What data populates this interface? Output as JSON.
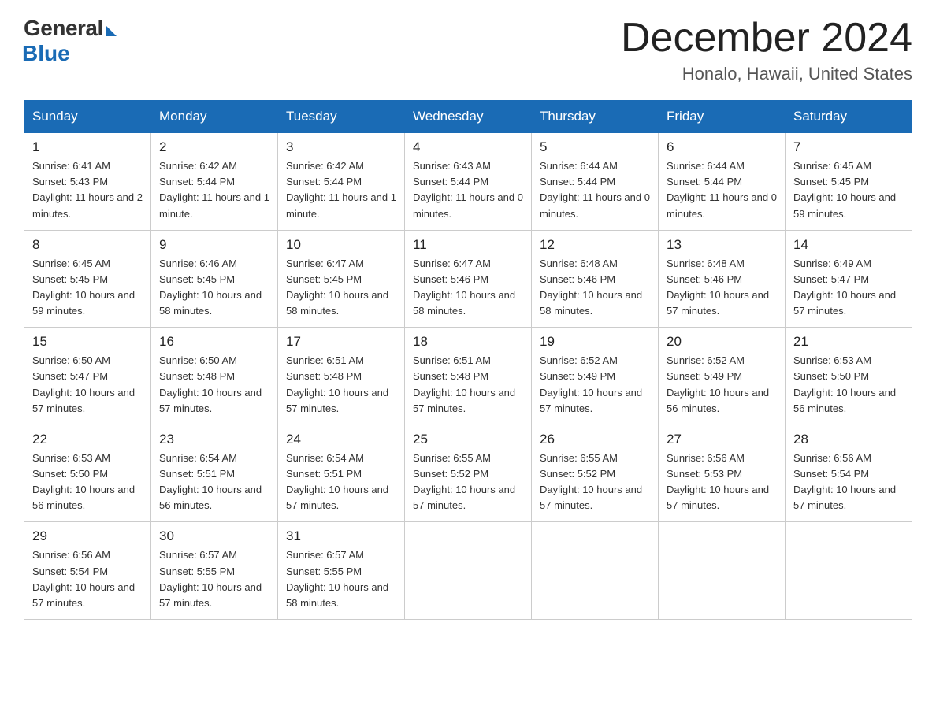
{
  "logo": {
    "general": "General",
    "blue": "Blue"
  },
  "title": "December 2024",
  "location": "Honalo, Hawaii, United States",
  "weekdays": [
    "Sunday",
    "Monday",
    "Tuesday",
    "Wednesday",
    "Thursday",
    "Friday",
    "Saturday"
  ],
  "weeks": [
    [
      {
        "day": "1",
        "sunrise": "6:41 AM",
        "sunset": "5:43 PM",
        "daylight": "11 hours and 2 minutes."
      },
      {
        "day": "2",
        "sunrise": "6:42 AM",
        "sunset": "5:44 PM",
        "daylight": "11 hours and 1 minute."
      },
      {
        "day": "3",
        "sunrise": "6:42 AM",
        "sunset": "5:44 PM",
        "daylight": "11 hours and 1 minute."
      },
      {
        "day": "4",
        "sunrise": "6:43 AM",
        "sunset": "5:44 PM",
        "daylight": "11 hours and 0 minutes."
      },
      {
        "day": "5",
        "sunrise": "6:44 AM",
        "sunset": "5:44 PM",
        "daylight": "11 hours and 0 minutes."
      },
      {
        "day": "6",
        "sunrise": "6:44 AM",
        "sunset": "5:44 PM",
        "daylight": "11 hours and 0 minutes."
      },
      {
        "day": "7",
        "sunrise": "6:45 AM",
        "sunset": "5:45 PM",
        "daylight": "10 hours and 59 minutes."
      }
    ],
    [
      {
        "day": "8",
        "sunrise": "6:45 AM",
        "sunset": "5:45 PM",
        "daylight": "10 hours and 59 minutes."
      },
      {
        "day": "9",
        "sunrise": "6:46 AM",
        "sunset": "5:45 PM",
        "daylight": "10 hours and 58 minutes."
      },
      {
        "day": "10",
        "sunrise": "6:47 AM",
        "sunset": "5:45 PM",
        "daylight": "10 hours and 58 minutes."
      },
      {
        "day": "11",
        "sunrise": "6:47 AM",
        "sunset": "5:46 PM",
        "daylight": "10 hours and 58 minutes."
      },
      {
        "day": "12",
        "sunrise": "6:48 AM",
        "sunset": "5:46 PM",
        "daylight": "10 hours and 58 minutes."
      },
      {
        "day": "13",
        "sunrise": "6:48 AM",
        "sunset": "5:46 PM",
        "daylight": "10 hours and 57 minutes."
      },
      {
        "day": "14",
        "sunrise": "6:49 AM",
        "sunset": "5:47 PM",
        "daylight": "10 hours and 57 minutes."
      }
    ],
    [
      {
        "day": "15",
        "sunrise": "6:50 AM",
        "sunset": "5:47 PM",
        "daylight": "10 hours and 57 minutes."
      },
      {
        "day": "16",
        "sunrise": "6:50 AM",
        "sunset": "5:48 PM",
        "daylight": "10 hours and 57 minutes."
      },
      {
        "day": "17",
        "sunrise": "6:51 AM",
        "sunset": "5:48 PM",
        "daylight": "10 hours and 57 minutes."
      },
      {
        "day": "18",
        "sunrise": "6:51 AM",
        "sunset": "5:48 PM",
        "daylight": "10 hours and 57 minutes."
      },
      {
        "day": "19",
        "sunrise": "6:52 AM",
        "sunset": "5:49 PM",
        "daylight": "10 hours and 57 minutes."
      },
      {
        "day": "20",
        "sunrise": "6:52 AM",
        "sunset": "5:49 PM",
        "daylight": "10 hours and 56 minutes."
      },
      {
        "day": "21",
        "sunrise": "6:53 AM",
        "sunset": "5:50 PM",
        "daylight": "10 hours and 56 minutes."
      }
    ],
    [
      {
        "day": "22",
        "sunrise": "6:53 AM",
        "sunset": "5:50 PM",
        "daylight": "10 hours and 56 minutes."
      },
      {
        "day": "23",
        "sunrise": "6:54 AM",
        "sunset": "5:51 PM",
        "daylight": "10 hours and 56 minutes."
      },
      {
        "day": "24",
        "sunrise": "6:54 AM",
        "sunset": "5:51 PM",
        "daylight": "10 hours and 57 minutes."
      },
      {
        "day": "25",
        "sunrise": "6:55 AM",
        "sunset": "5:52 PM",
        "daylight": "10 hours and 57 minutes."
      },
      {
        "day": "26",
        "sunrise": "6:55 AM",
        "sunset": "5:52 PM",
        "daylight": "10 hours and 57 minutes."
      },
      {
        "day": "27",
        "sunrise": "6:56 AM",
        "sunset": "5:53 PM",
        "daylight": "10 hours and 57 minutes."
      },
      {
        "day": "28",
        "sunrise": "6:56 AM",
        "sunset": "5:54 PM",
        "daylight": "10 hours and 57 minutes."
      }
    ],
    [
      {
        "day": "29",
        "sunrise": "6:56 AM",
        "sunset": "5:54 PM",
        "daylight": "10 hours and 57 minutes."
      },
      {
        "day": "30",
        "sunrise": "6:57 AM",
        "sunset": "5:55 PM",
        "daylight": "10 hours and 57 minutes."
      },
      {
        "day": "31",
        "sunrise": "6:57 AM",
        "sunset": "5:55 PM",
        "daylight": "10 hours and 58 minutes."
      },
      null,
      null,
      null,
      null
    ]
  ]
}
